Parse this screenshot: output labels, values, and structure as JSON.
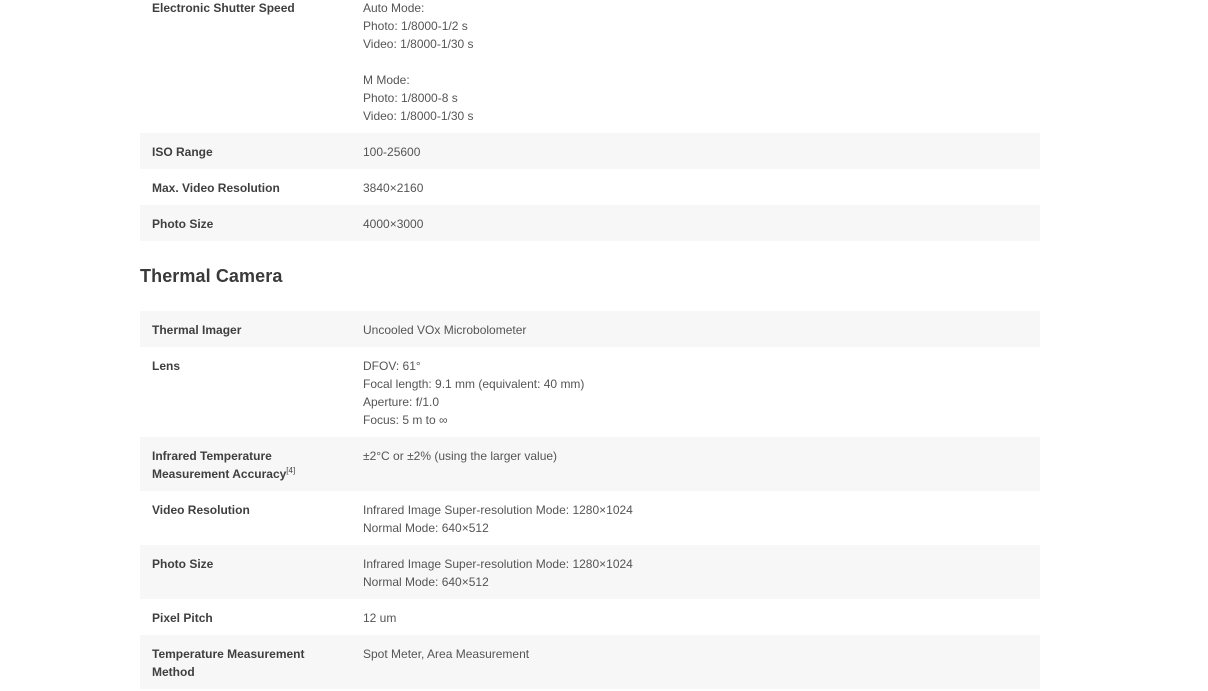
{
  "camera": {
    "rows": [
      {
        "label": "Electronic Shutter Speed",
        "lines": [
          "Auto Mode:",
          "Photo: 1/8000-1/2 s",
          "Video: 1/8000-1/30 s",
          "",
          "M Mode:",
          "Photo: 1/8000-8 s",
          "Video: 1/8000-1/30 s"
        ]
      },
      {
        "label": "ISO Range",
        "lines": [
          "100-25600"
        ]
      },
      {
        "label": "Max. Video Resolution",
        "lines": [
          "3840×2160"
        ]
      },
      {
        "label": "Photo Size",
        "lines": [
          "4000×3000"
        ]
      }
    ]
  },
  "thermal": {
    "title": "Thermal Camera",
    "rows": [
      {
        "label": "Thermal Imager",
        "lines": [
          "Uncooled VOx Microbolometer"
        ]
      },
      {
        "label": "Lens",
        "lines": [
          "DFOV: 61°",
          "Focal length: 9.1 mm (equivalent: 40 mm)",
          "Aperture: f/1.0",
          "Focus: 5 m to ∞"
        ]
      },
      {
        "label_line1": "Infrared Temperature",
        "label_line2": "Measurement Accuracy",
        "footnote": "[4]",
        "lines": [
          "±2°C or ±2% (using the larger value)"
        ]
      },
      {
        "label": "Video Resolution",
        "lines": [
          "Infrared Image Super-resolution Mode: 1280×1024",
          "Normal Mode: 640×512"
        ]
      },
      {
        "label": "Photo Size",
        "lines": [
          "Infrared Image Super-resolution Mode: 1280×1024",
          "Normal Mode: 640×512"
        ]
      },
      {
        "label": "Pixel Pitch",
        "lines": [
          "12 um"
        ]
      },
      {
        "label_line1": "Temperature Measurement",
        "label_line2": "Method",
        "lines": [
          "Spot Meter, Area Measurement"
        ]
      }
    ]
  }
}
